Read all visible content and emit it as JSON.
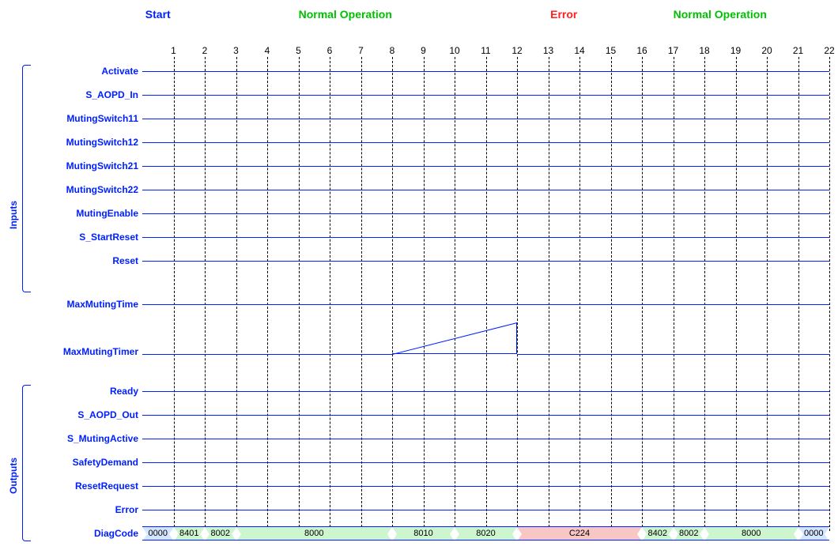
{
  "chart_data": {
    "type": "timing-diagram",
    "time_steps": 22,
    "phases": [
      {
        "label": "Start",
        "span": [
          0,
          1
        ],
        "color": "#0020ff"
      },
      {
        "label": "Normal Operation",
        "span": [
          1,
          12
        ],
        "color": "#00c000"
      },
      {
        "label": "Error",
        "span": [
          12,
          15
        ],
        "color": "#ff2020"
      },
      {
        "label": "Normal Operation",
        "span": [
          15,
          22
        ],
        "color": "#00c000"
      }
    ],
    "inputs": [
      "Activate",
      "S_AOPD_In",
      "MutingSwitch11",
      "MutingSwitch12",
      "MutingSwitch21",
      "MutingSwitch22",
      "MutingEnable",
      "S_StartReset",
      "Reset"
    ],
    "internal": [
      "MaxMutingTime",
      "MaxMutingTimer"
    ],
    "outputs": [
      "Ready",
      "S_AOPD_Out",
      "S_MutingActive",
      "SafetyDemand",
      "ResetRequest",
      "Error",
      "DiagCode"
    ],
    "diagcode": [
      {
        "code": "0000",
        "from": 0,
        "to": 1,
        "state": "blue"
      },
      {
        "code": "8401",
        "from": 1,
        "to": 2,
        "state": "green"
      },
      {
        "code": "8002",
        "from": 2,
        "to": 3,
        "state": "green"
      },
      {
        "code": "8000",
        "from": 3,
        "to": 8,
        "state": "green"
      },
      {
        "code": "8010",
        "from": 8,
        "to": 10,
        "state": "green"
      },
      {
        "code": "8020",
        "from": 10,
        "to": 12,
        "state": "green"
      },
      {
        "code": "C224",
        "from": 12,
        "to": 16,
        "state": "red"
      },
      {
        "code": "8402",
        "from": 16,
        "to": 17,
        "state": "green"
      },
      {
        "code": "8002",
        "from": 17,
        "to": 18,
        "state": "green"
      },
      {
        "code": "8000",
        "from": 18,
        "to": 21,
        "state": "green"
      },
      {
        "code": "0000",
        "from": 21,
        "to": 22,
        "state": "blue"
      }
    ],
    "timer_ramp": {
      "signal": "MaxMutingTimer",
      "from": 8,
      "to": 12
    }
  },
  "labels": {
    "inputs_axis": "Inputs",
    "outputs_axis": "Outputs"
  }
}
